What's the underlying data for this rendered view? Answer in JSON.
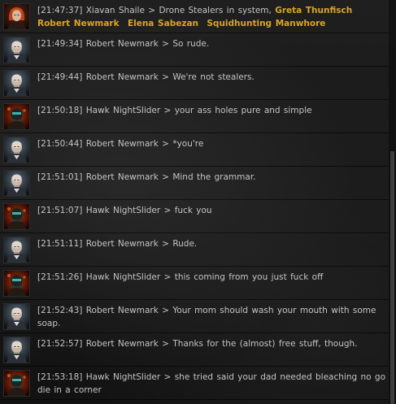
{
  "chat": {
    "separator": ">",
    "messages": [
      {
        "time": "[21:47:37]",
        "sender": "Xiavan Shaile",
        "portrait": "portrait-red-hair",
        "text": "Drone Stealers in system,",
        "links": [
          "Greta Thunfisch",
          "Robert Newmark",
          "Elena Sabezan",
          "Squidhunting Manwhore"
        ]
      },
      {
        "time": "[21:49:34]",
        "sender": "Robert Newmark",
        "portrait": "portrait-bald-man",
        "text": "So rude."
      },
      {
        "time": "[21:49:44]",
        "sender": "Robert Newmark",
        "portrait": "portrait-bald-man",
        "text": "We're not stealers."
      },
      {
        "time": "[21:50:18]",
        "sender": "Hawk NightSlider",
        "portrait": "portrait-masked-fire",
        "text": "your ass holes pure and simple"
      },
      {
        "time": "[21:50:44]",
        "sender": "Robert Newmark",
        "portrait": "portrait-bald-man",
        "text": "*you're"
      },
      {
        "time": "[21:51:01]",
        "sender": "Robert Newmark",
        "portrait": "portrait-bald-man",
        "text": "Mind the grammar."
      },
      {
        "time": "[21:51:07]",
        "sender": "Hawk NightSlider",
        "portrait": "portrait-masked-fire",
        "text": "fuck you"
      },
      {
        "time": "[21:51:11]",
        "sender": "Robert Newmark",
        "portrait": "portrait-bald-man",
        "text": "Rude."
      },
      {
        "time": "[21:51:26]",
        "sender": "Hawk NightSlider",
        "portrait": "portrait-masked-fire",
        "text": "this coming from you just fuck off"
      },
      {
        "time": "[21:52:43]",
        "sender": "Robert Newmark",
        "portrait": "portrait-bald-man",
        "text": "Your mom should wash your mouth with some soap."
      },
      {
        "time": "[21:52:57]",
        "sender": "Robert Newmark",
        "portrait": "portrait-bald-man",
        "text": "Thanks for the (almost) free stuff, though."
      },
      {
        "time": "[21:53:18]",
        "sender": "Hawk NightSlider",
        "portrait": "portrait-masked-fire",
        "text": "she tried said your dad needed bleaching no go die in a corner"
      }
    ]
  },
  "colors": {
    "text": "#c4c4c4",
    "link": "#d9a425",
    "background": "#191919",
    "scroll_thumb": "#3d3d3d"
  }
}
